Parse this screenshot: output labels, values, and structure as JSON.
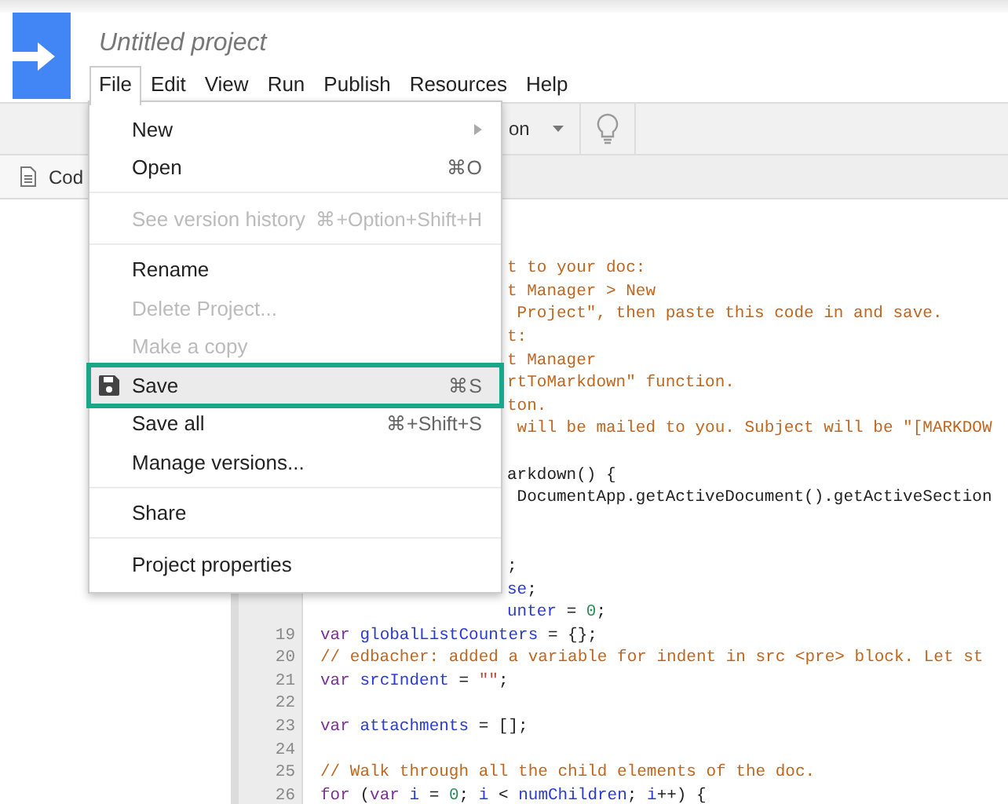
{
  "header": {
    "title": "Untitled project"
  },
  "menubar": [
    {
      "label": "File",
      "selected": true
    },
    {
      "label": "Edit",
      "selected": false
    },
    {
      "label": "View",
      "selected": false
    },
    {
      "label": "Run",
      "selected": false
    },
    {
      "label": "Publish",
      "selected": false
    },
    {
      "label": "Resources",
      "selected": false
    },
    {
      "label": "Help",
      "selected": false
    }
  ],
  "toolbar": {
    "function_select": "on"
  },
  "tabs": [
    {
      "label": "Cod"
    }
  ],
  "file_menu": [
    [
      {
        "kind": "submenu",
        "label": "New",
        "disabled": false,
        "selected": false
      },
      {
        "kind": "item",
        "label": "Open",
        "shortcut": "⌘O",
        "disabled": false,
        "selected": false
      }
    ],
    [
      {
        "kind": "item",
        "label": "See version history",
        "shortcut": "⌘+Option+Shift+H",
        "disabled": true,
        "selected": false
      }
    ],
    [
      {
        "kind": "item",
        "label": "Rename",
        "disabled": false,
        "selected": false
      },
      {
        "kind": "item",
        "label": "Delete Project...",
        "disabled": true,
        "selected": false
      },
      {
        "kind": "item",
        "label": "Make a copy",
        "disabled": true,
        "selected": false
      },
      {
        "kind": "icon",
        "label": "Save",
        "shortcut": "⌘S",
        "disabled": false,
        "selected": true
      },
      {
        "kind": "item",
        "label": "Save all",
        "shortcut": "⌘+Shift+S",
        "disabled": false,
        "selected": false
      },
      {
        "kind": "item",
        "label": "Manage versions...",
        "disabled": false,
        "selected": false
      }
    ],
    [
      {
        "kind": "item",
        "label": "Share",
        "disabled": false,
        "selected": false
      }
    ],
    [
      {
        "kind": "item",
        "label": "Project properties",
        "disabled": false,
        "selected": false
      }
    ]
  ],
  "code_lines": [
    {
      "kind": "blank"
    },
    {
      "kind": "blank"
    },
    {
      "kind": "partial",
      "tokens": [
        {
          "kind": "comment",
          "text": "t to your doc:"
        }
      ]
    },
    {
      "kind": "partial",
      "tokens": [
        {
          "kind": "comment",
          "text": "t Manager > New"
        }
      ]
    },
    {
      "kind": "partial",
      "tokens": [
        {
          "kind": "comment",
          "text": " Project\", then paste this code in and save."
        }
      ]
    },
    {
      "kind": "partial",
      "tokens": [
        {
          "kind": "comment",
          "text": "t:"
        }
      ]
    },
    {
      "kind": "partial",
      "tokens": [
        {
          "kind": "comment",
          "text": "t Manager"
        }
      ]
    },
    {
      "kind": "partial",
      "tokens": [
        {
          "kind": "comment",
          "text": "rtToMarkdown\" function."
        }
      ]
    },
    {
      "kind": "partial",
      "tokens": [
        {
          "kind": "comment",
          "text": "ton."
        }
      ]
    },
    {
      "kind": "partial",
      "tokens": [
        {
          "kind": "comment",
          "text": " will be mailed to you. Subject will be \"[MARKDOW"
        }
      ]
    },
    {
      "kind": "blank"
    },
    {
      "kind": "partial",
      "tokens": [
        {
          "kind": "plain",
          "text": "arkdown() {"
        }
      ]
    },
    {
      "kind": "partial",
      "tokens": [
        {
          "kind": "plain",
          "text": " DocumentApp.getActiveDocument().getActiveSection"
        }
      ]
    },
    {
      "kind": "blank"
    },
    {
      "kind": "blank"
    },
    {
      "kind": "partial",
      "tokens": [
        {
          "kind": "plain",
          "text": ";"
        }
      ]
    },
    {
      "kind": "partial",
      "tokens": [
        {
          "kind": "ident",
          "text": "se"
        },
        {
          "kind": "plain",
          "text": ";"
        }
      ]
    },
    {
      "kind": "partial",
      "tokens": [
        {
          "kind": "ident",
          "text": "unter"
        },
        {
          "kind": "plain",
          "text": " = "
        },
        {
          "kind": "number",
          "text": "0"
        },
        {
          "kind": "plain",
          "text": ";"
        }
      ]
    },
    {
      "kind": "full",
      "number": "19",
      "tokens": [
        {
          "kind": "keyword",
          "text": "var "
        },
        {
          "kind": "ident",
          "text": "globalListCounters"
        },
        {
          "kind": "plain",
          "text": " = {};"
        }
      ]
    },
    {
      "kind": "full",
      "number": "20",
      "tokens": [
        {
          "kind": "comment",
          "text": "// edbacher: added a variable for indent in src <pre> block. Let st"
        }
      ]
    },
    {
      "kind": "full",
      "number": "21",
      "tokens": [
        {
          "kind": "keyword",
          "text": "var "
        },
        {
          "kind": "ident",
          "text": "srcIndent"
        },
        {
          "kind": "plain",
          "text": " = "
        },
        {
          "kind": "string",
          "text": "\"\""
        },
        {
          "kind": "plain",
          "text": ";"
        }
      ]
    },
    {
      "kind": "full",
      "number": "22"
    },
    {
      "kind": "full",
      "number": "23",
      "tokens": [
        {
          "kind": "keyword",
          "text": "var "
        },
        {
          "kind": "ident",
          "text": "attachments"
        },
        {
          "kind": "plain",
          "text": " = [];"
        }
      ]
    },
    {
      "kind": "full",
      "number": "24"
    },
    {
      "kind": "full",
      "number": "25",
      "tokens": [
        {
          "kind": "comment",
          "text": "// Walk through all the child elements of the doc."
        }
      ]
    },
    {
      "kind": "full",
      "number": "26",
      "tokens": [
        {
          "kind": "keyword",
          "text": "for"
        },
        {
          "kind": "plain",
          "text": " ("
        },
        {
          "kind": "keyword",
          "text": "var "
        },
        {
          "kind": "ident",
          "text": "i"
        },
        {
          "kind": "plain",
          "text": " = "
        },
        {
          "kind": "number",
          "text": "0"
        },
        {
          "kind": "plain",
          "text": "; "
        },
        {
          "kind": "ident",
          "text": "i"
        },
        {
          "kind": "plain",
          "text": " < "
        },
        {
          "kind": "ident",
          "text": "numChildren"
        },
        {
          "kind": "plain",
          "text": "; "
        },
        {
          "kind": "ident",
          "text": "i"
        },
        {
          "kind": "plain",
          "text": "++) {"
        }
      ]
    }
  ]
}
